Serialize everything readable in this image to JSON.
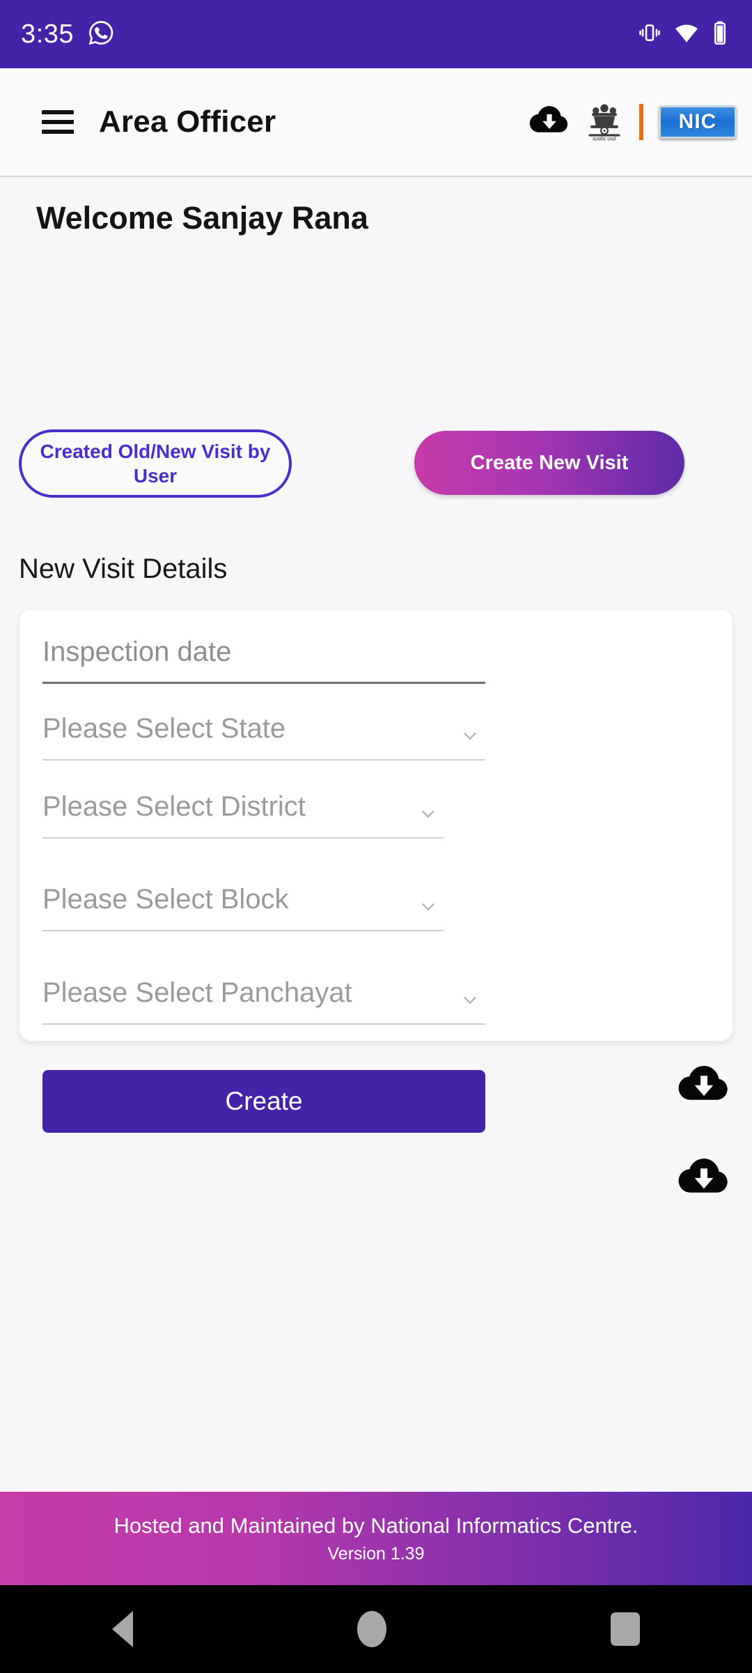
{
  "status_bar": {
    "time": "3:35",
    "app_icon": "whatsapp-icon",
    "icons": [
      "vibrate-icon",
      "wifi-icon",
      "battery-icon"
    ]
  },
  "app_bar": {
    "menu_icon": "hamburger-menu-icon",
    "title": "Area Officer",
    "download_icon": "cloud-download-icon",
    "emblem_icon": "india-national-emblem-icon",
    "logo_text": "NIC"
  },
  "main": {
    "welcome": "Welcome Sanjay Rana",
    "created_visits_button": "Created Old/New Visit by User",
    "create_new_visit_button": "Create New Visit",
    "section_title": "New Visit Details",
    "fields": [
      {
        "name": "inspection-date",
        "placeholder": "Inspection date",
        "value": "",
        "has_chevron": false,
        "has_cloud": false
      },
      {
        "name": "state",
        "placeholder": "Please Select State",
        "value": "",
        "has_chevron": true,
        "has_cloud": false
      },
      {
        "name": "district",
        "placeholder": "Please Select District",
        "value": "",
        "has_chevron": true,
        "has_cloud": true
      },
      {
        "name": "block",
        "placeholder": "Please Select Block",
        "value": "",
        "has_chevron": true,
        "has_cloud": true
      },
      {
        "name": "panchayat",
        "placeholder": "Please Select Panchayat",
        "value": "",
        "has_chevron": true,
        "has_cloud": false
      }
    ],
    "submit_button": "Create"
  },
  "footer": {
    "line1": "Hosted and Maintained by National Informatics Centre.",
    "line2": "Version 1.39"
  },
  "nav_bar": {
    "back": "back-icon",
    "home": "home-icon",
    "recents": "recents-icon"
  },
  "colors": {
    "status_bar": "#4423a8",
    "primary": "#4423a8",
    "outline_accent": "#4b2ecb",
    "gradient_start": "#c73ba8",
    "gradient_end": "#5e2aa8",
    "divider_orange": "#e8700f",
    "nic_blue": "#1a6fd4"
  }
}
